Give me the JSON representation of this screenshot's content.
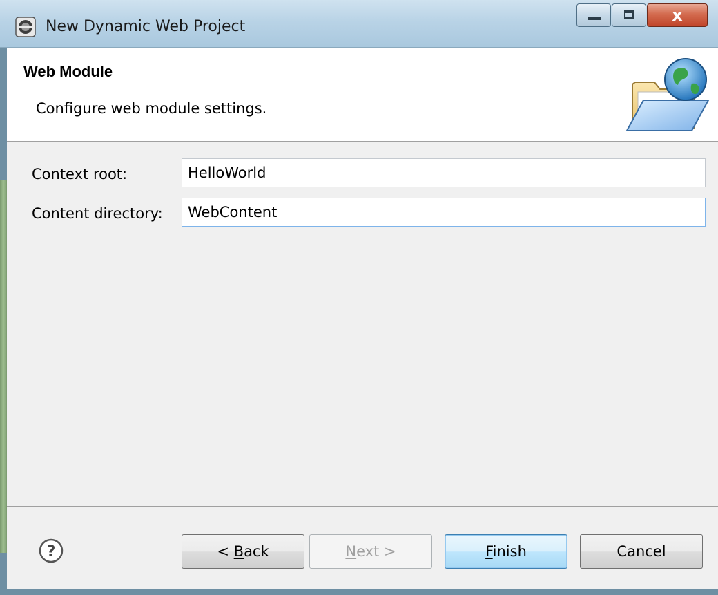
{
  "window": {
    "title": "New Dynamic Web Project",
    "controls": {
      "minimize_icon": "minimize-icon",
      "maximize_icon": "maximize-icon",
      "close_label": "x"
    }
  },
  "header": {
    "title": "Web Module",
    "subtitle": "Configure web module settings.",
    "icon": "folder-globe-icon"
  },
  "form": {
    "context_root": {
      "label": "Context root:",
      "value": "HelloWorld"
    },
    "content_directory": {
      "label": "Content directory:",
      "value": "WebContent"
    }
  },
  "footer": {
    "help_icon": "help-icon",
    "back": {
      "prefix": "< ",
      "mnemonic": "B",
      "rest": "ack"
    },
    "next": {
      "mnemonic": "N",
      "rest": "ext >",
      "enabled": false
    },
    "finish": {
      "mnemonic": "F",
      "rest": "inish"
    },
    "cancel": {
      "label": "Cancel"
    }
  },
  "colors": {
    "titlebar": "#b9d3e6",
    "close_button": "#c0452a",
    "focus_border": "#7eb4ea",
    "default_button": "#bee6fd"
  }
}
